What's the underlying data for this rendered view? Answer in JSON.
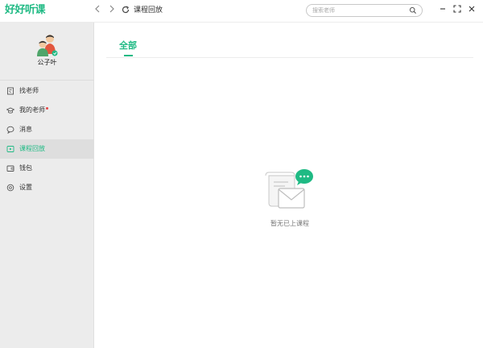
{
  "app": {
    "logo_text": "好好听课",
    "brand_color": "#1fba84"
  },
  "titlebar": {
    "page_title": "课程回放",
    "search_placeholder": "搜索老师"
  },
  "profile": {
    "username": "公子叶"
  },
  "sidebar": {
    "items": [
      {
        "label": "找老师",
        "icon": "find-teacher-icon"
      },
      {
        "label": "我的老师",
        "icon": "graduation-cap-icon",
        "has_dot": true
      },
      {
        "label": "消息",
        "icon": "chat-bubble-icon"
      },
      {
        "label": "课程回放",
        "icon": "play-icon",
        "active": true
      },
      {
        "label": "钱包",
        "icon": "wallet-icon"
      },
      {
        "label": "设置",
        "icon": "settings-icon"
      }
    ]
  },
  "main": {
    "tabs": [
      {
        "label": "全部",
        "active": true
      }
    ],
    "empty_text": "暂无已上课程"
  }
}
